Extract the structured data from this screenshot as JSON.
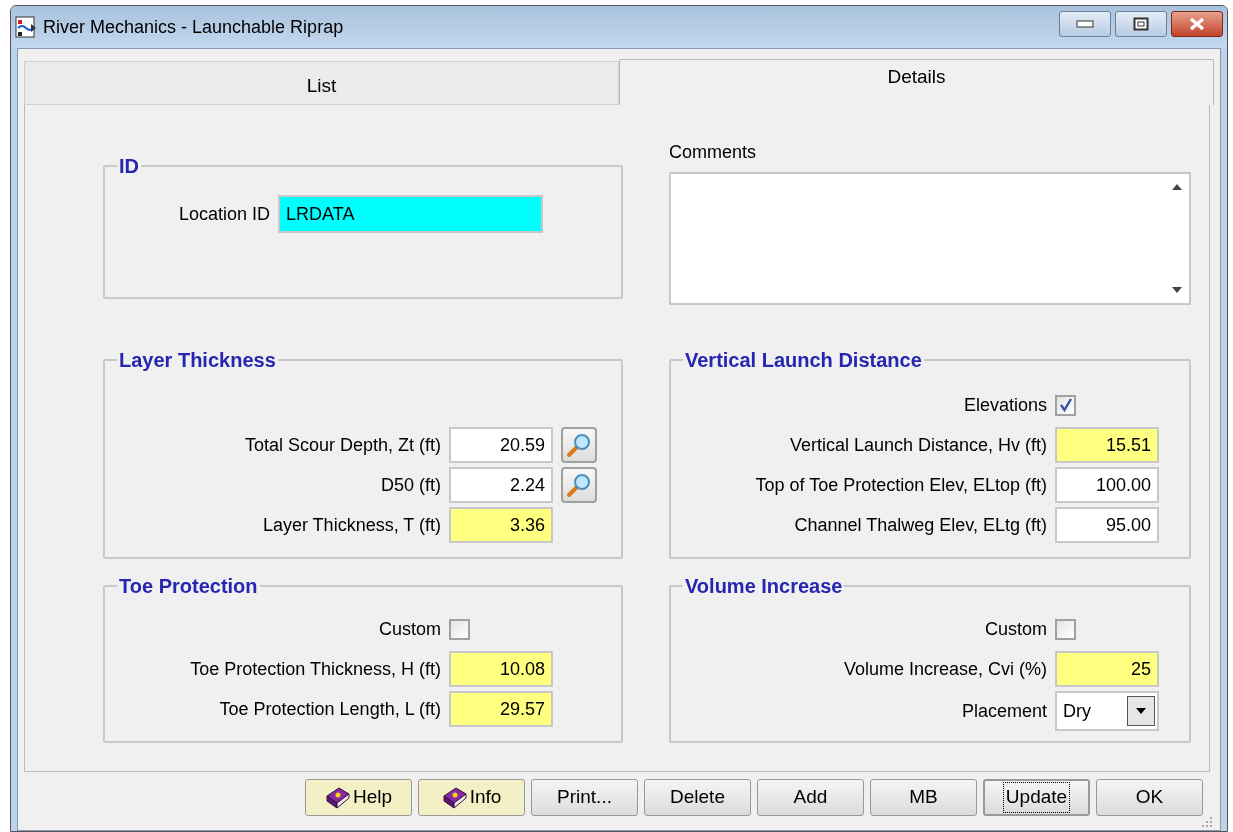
{
  "window": {
    "title": "River Mechanics - Launchable Riprap"
  },
  "tabs": [
    {
      "label": "List",
      "selected": false
    },
    {
      "label": "Details",
      "selected": true
    }
  ],
  "groups": [
    {
      "title": "ID",
      "rows": [
        {
          "kind": "key",
          "label": "Location ID",
          "value": "LRDATA"
        }
      ]
    },
    {
      "title": "Layer Thickness",
      "rows": [
        {
          "kind": "input",
          "label": "Total Scour Depth, Zt (ft)",
          "value": "20.59",
          "lookup": true
        },
        {
          "kind": "input",
          "label": "D50 (ft)",
          "value": "2.24",
          "lookup": true
        },
        {
          "kind": "computed",
          "label": "Layer Thickness, T (ft)",
          "value": "3.36"
        }
      ]
    },
    {
      "title": "Vertical Launch Distance",
      "rows": [
        {
          "kind": "checkbox",
          "label": "Elevations",
          "checked": true
        },
        {
          "kind": "computed",
          "label": "Vertical Launch Distance, Hv (ft)",
          "value": "15.51"
        },
        {
          "kind": "input",
          "label": "Top of Toe Protection Elev, ELtop (ft)",
          "value": "100.00"
        },
        {
          "kind": "input",
          "label": "Channel Thalweg Elev, ELtg (ft)",
          "value": "95.00"
        }
      ]
    },
    {
      "title": "Toe Protection",
      "rows": [
        {
          "kind": "checkbox",
          "label": "Custom",
          "checked": false
        },
        {
          "kind": "computed",
          "label": "Toe Protection Thickness, H (ft)",
          "value": "10.08"
        },
        {
          "kind": "computed",
          "label": "Toe Protection Length, L (ft)",
          "value": "29.57"
        }
      ]
    },
    {
      "title": "Volume Increase",
      "rows": [
        {
          "kind": "checkbox",
          "label": "Custom",
          "checked": false
        },
        {
          "kind": "computed",
          "label": "Volume Increase, Cvi (%)",
          "value": "25"
        },
        {
          "kind": "dropdown",
          "label": "Placement",
          "value": "Dry"
        }
      ]
    }
  ],
  "comments": {
    "label": "Comments"
  },
  "buttons": [
    {
      "label": "Help",
      "icon": true,
      "focused": false
    },
    {
      "label": "Info",
      "icon": true,
      "focused": false
    },
    {
      "label": "Print...",
      "icon": false,
      "focused": false
    },
    {
      "label": "Delete",
      "icon": false,
      "focused": false
    },
    {
      "label": "Add",
      "icon": false,
      "focused": false
    },
    {
      "label": "MB",
      "icon": false,
      "focused": false
    },
    {
      "label": "Update",
      "icon": false,
      "focused": true
    },
    {
      "label": "OK",
      "icon": false,
      "focused": false
    }
  ]
}
